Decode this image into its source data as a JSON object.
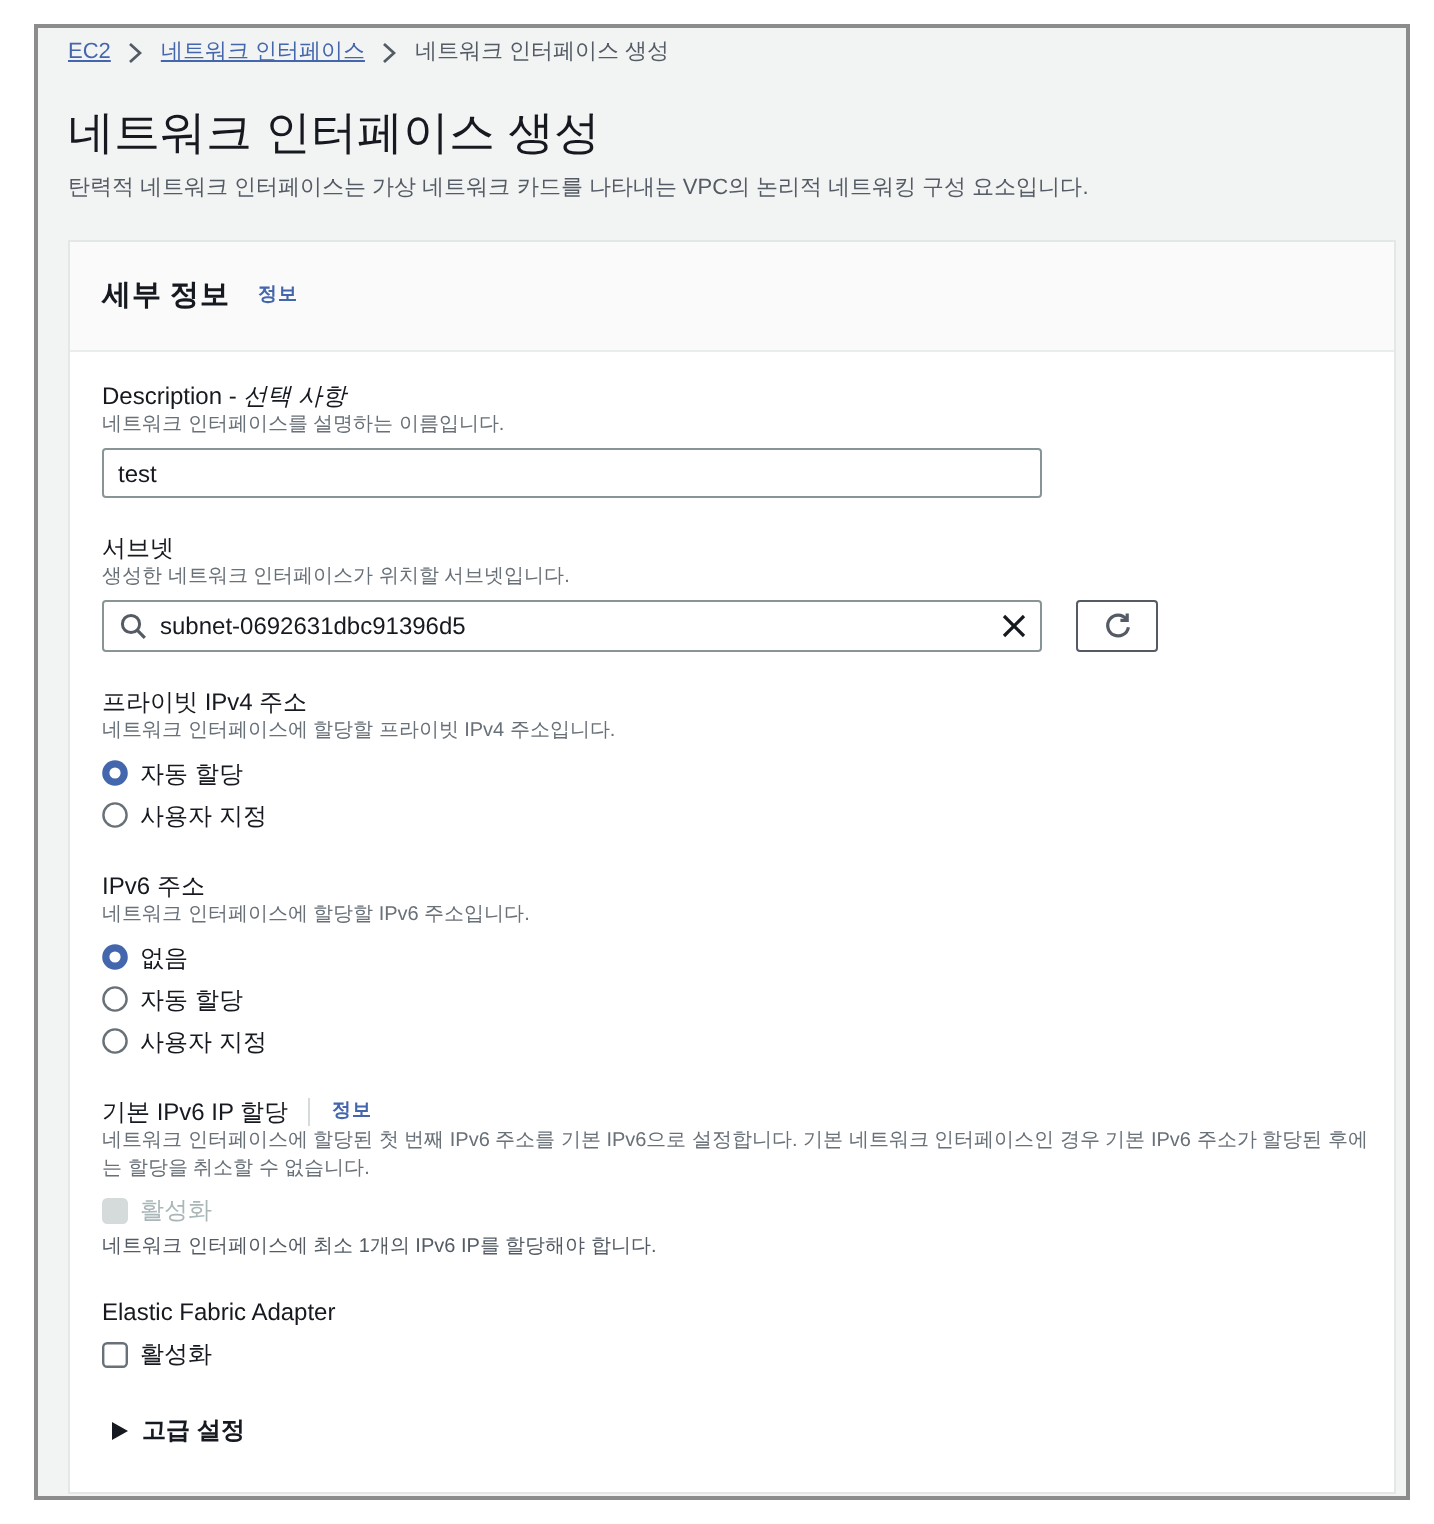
{
  "breadcrumb": [
    {
      "label": "EC2",
      "kind": "link"
    },
    {
      "label": "네트워크 인터페이스",
      "kind": "link"
    },
    {
      "label": "네트워크 인터페이스 생성",
      "kind": "current"
    }
  ],
  "page": {
    "title": "네트워크 인터페이스 생성",
    "description": "탄력적 네트워크 인터페이스는 가상 네트워크 카드를 나타내는 VPC의 논리적 네트워킹 구성 요소입니다."
  },
  "panel": {
    "title": "세부 정보",
    "info_link": "정보"
  },
  "fields": [
    {
      "kind": "text",
      "label": "Description - *선택 사항*",
      "hint": "네트워크 인터페이스를 설명하는 이름입니다.",
      "value": "test"
    },
    {
      "kind": "search",
      "label": "서브넷",
      "hint": "생성한 네트워크 인터페이스가 위치할 서브넷입니다.",
      "value": "subnet-0692631dbc91396d5"
    },
    {
      "kind": "radio",
      "label": "프라이빗 IPv4 주소",
      "hint": "네트워크 인터페이스에 할당할 프라이빗 IPv4 주소입니다.",
      "options": [
        {
          "label": "자동 할당",
          "selected": true
        },
        {
          "label": "사용자 지정",
          "selected": false
        }
      ]
    },
    {
      "kind": "radio",
      "label": "IPv6 주소",
      "hint": "네트워크 인터페이스에 할당할 IPv6 주소입니다.",
      "options": [
        {
          "label": "없음",
          "selected": true
        },
        {
          "label": "자동 할당",
          "selected": false
        },
        {
          "label": "사용자 지정",
          "selected": false
        }
      ]
    },
    {
      "kind": "checkbox",
      "label": "기본 IPv6 IP 할당",
      "info_link": "정보",
      "hint": "네트워크 인터페이스에 할당된 첫 번째 IPv6 주소를 기본 IPv6으로 설정합니다. 기본 네트워크 인터페이스인 경우 기본 IPv6 주소가 할당된 후에는 할당을 취소할 수 없습니다.",
      "option": {
        "label": "활성화",
        "checked": false,
        "disabled": true
      },
      "note": "네트워크 인터페이스에 최소 1개의 IPv6 IP를 할당해야 합니다."
    },
    {
      "kind": "checkbox",
      "label": "Elastic Fabric Adapter",
      "option": {
        "label": "활성화",
        "checked": false,
        "disabled": false
      }
    }
  ],
  "advanced": {
    "label": "고급 설정",
    "expanded": false
  }
}
